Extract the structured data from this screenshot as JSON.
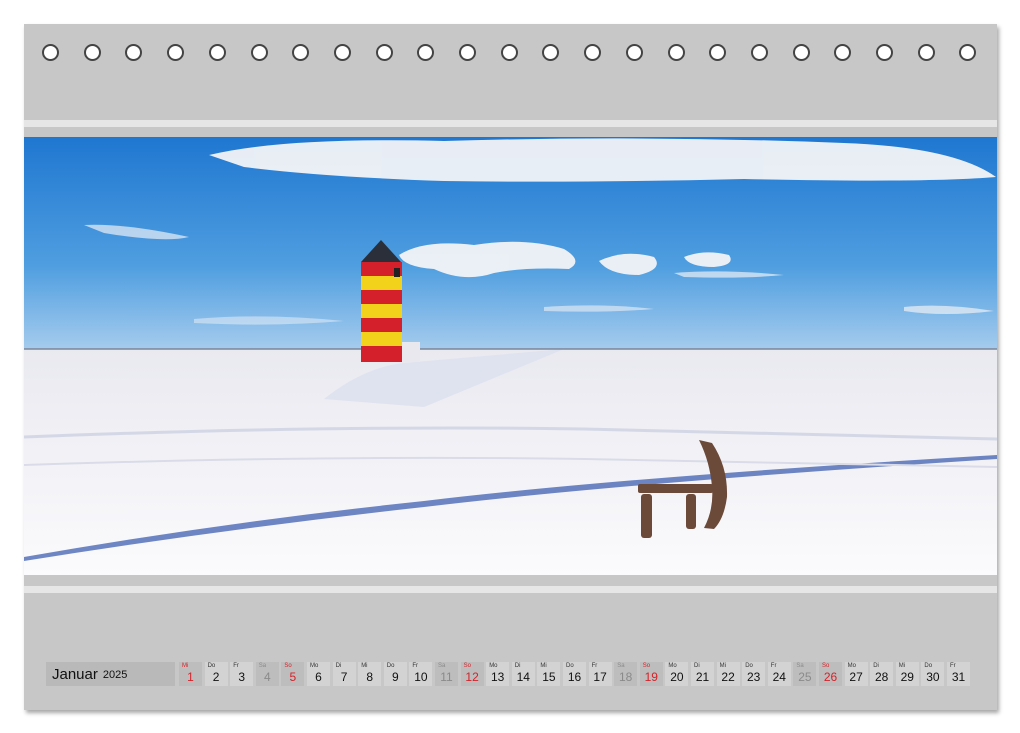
{
  "month": {
    "name": "Januar",
    "year": "2025"
  },
  "days": [
    {
      "wd": "Mi",
      "n": "1",
      "type": "sun"
    },
    {
      "wd": "Do",
      "n": "2",
      "type": ""
    },
    {
      "wd": "Fr",
      "n": "3",
      "type": ""
    },
    {
      "wd": "Sa",
      "n": "4",
      "type": "sat"
    },
    {
      "wd": "So",
      "n": "5",
      "type": "sun"
    },
    {
      "wd": "Mo",
      "n": "6",
      "type": ""
    },
    {
      "wd": "Di",
      "n": "7",
      "type": ""
    },
    {
      "wd": "Mi",
      "n": "8",
      "type": ""
    },
    {
      "wd": "Do",
      "n": "9",
      "type": ""
    },
    {
      "wd": "Fr",
      "n": "10",
      "type": ""
    },
    {
      "wd": "Sa",
      "n": "11",
      "type": "sat"
    },
    {
      "wd": "So",
      "n": "12",
      "type": "sun"
    },
    {
      "wd": "Mo",
      "n": "13",
      "type": ""
    },
    {
      "wd": "Di",
      "n": "14",
      "type": ""
    },
    {
      "wd": "Mi",
      "n": "15",
      "type": ""
    },
    {
      "wd": "Do",
      "n": "16",
      "type": ""
    },
    {
      "wd": "Fr",
      "n": "17",
      "type": ""
    },
    {
      "wd": "Sa",
      "n": "18",
      "type": "sat"
    },
    {
      "wd": "So",
      "n": "19",
      "type": "sun"
    },
    {
      "wd": "Mo",
      "n": "20",
      "type": ""
    },
    {
      "wd": "Di",
      "n": "21",
      "type": ""
    },
    {
      "wd": "Mi",
      "n": "22",
      "type": ""
    },
    {
      "wd": "Do",
      "n": "23",
      "type": ""
    },
    {
      "wd": "Fr",
      "n": "24",
      "type": ""
    },
    {
      "wd": "Sa",
      "n": "25",
      "type": "sat"
    },
    {
      "wd": "So",
      "n": "26",
      "type": "sun"
    },
    {
      "wd": "Mo",
      "n": "27",
      "type": ""
    },
    {
      "wd": "Di",
      "n": "28",
      "type": ""
    },
    {
      "wd": "Mi",
      "n": "29",
      "type": ""
    },
    {
      "wd": "Do",
      "n": "30",
      "type": ""
    },
    {
      "wd": "Fr",
      "n": "31",
      "type": ""
    }
  ],
  "colors": {
    "frame": "#c7c7c7",
    "sunday": "#d2232a",
    "saturday": "#8a8a8a",
    "sky": "#2f86d6",
    "snow": "#f4f4f8",
    "lighthouse_red": "#d3202a",
    "lighthouse_yellow": "#f2d21b"
  }
}
